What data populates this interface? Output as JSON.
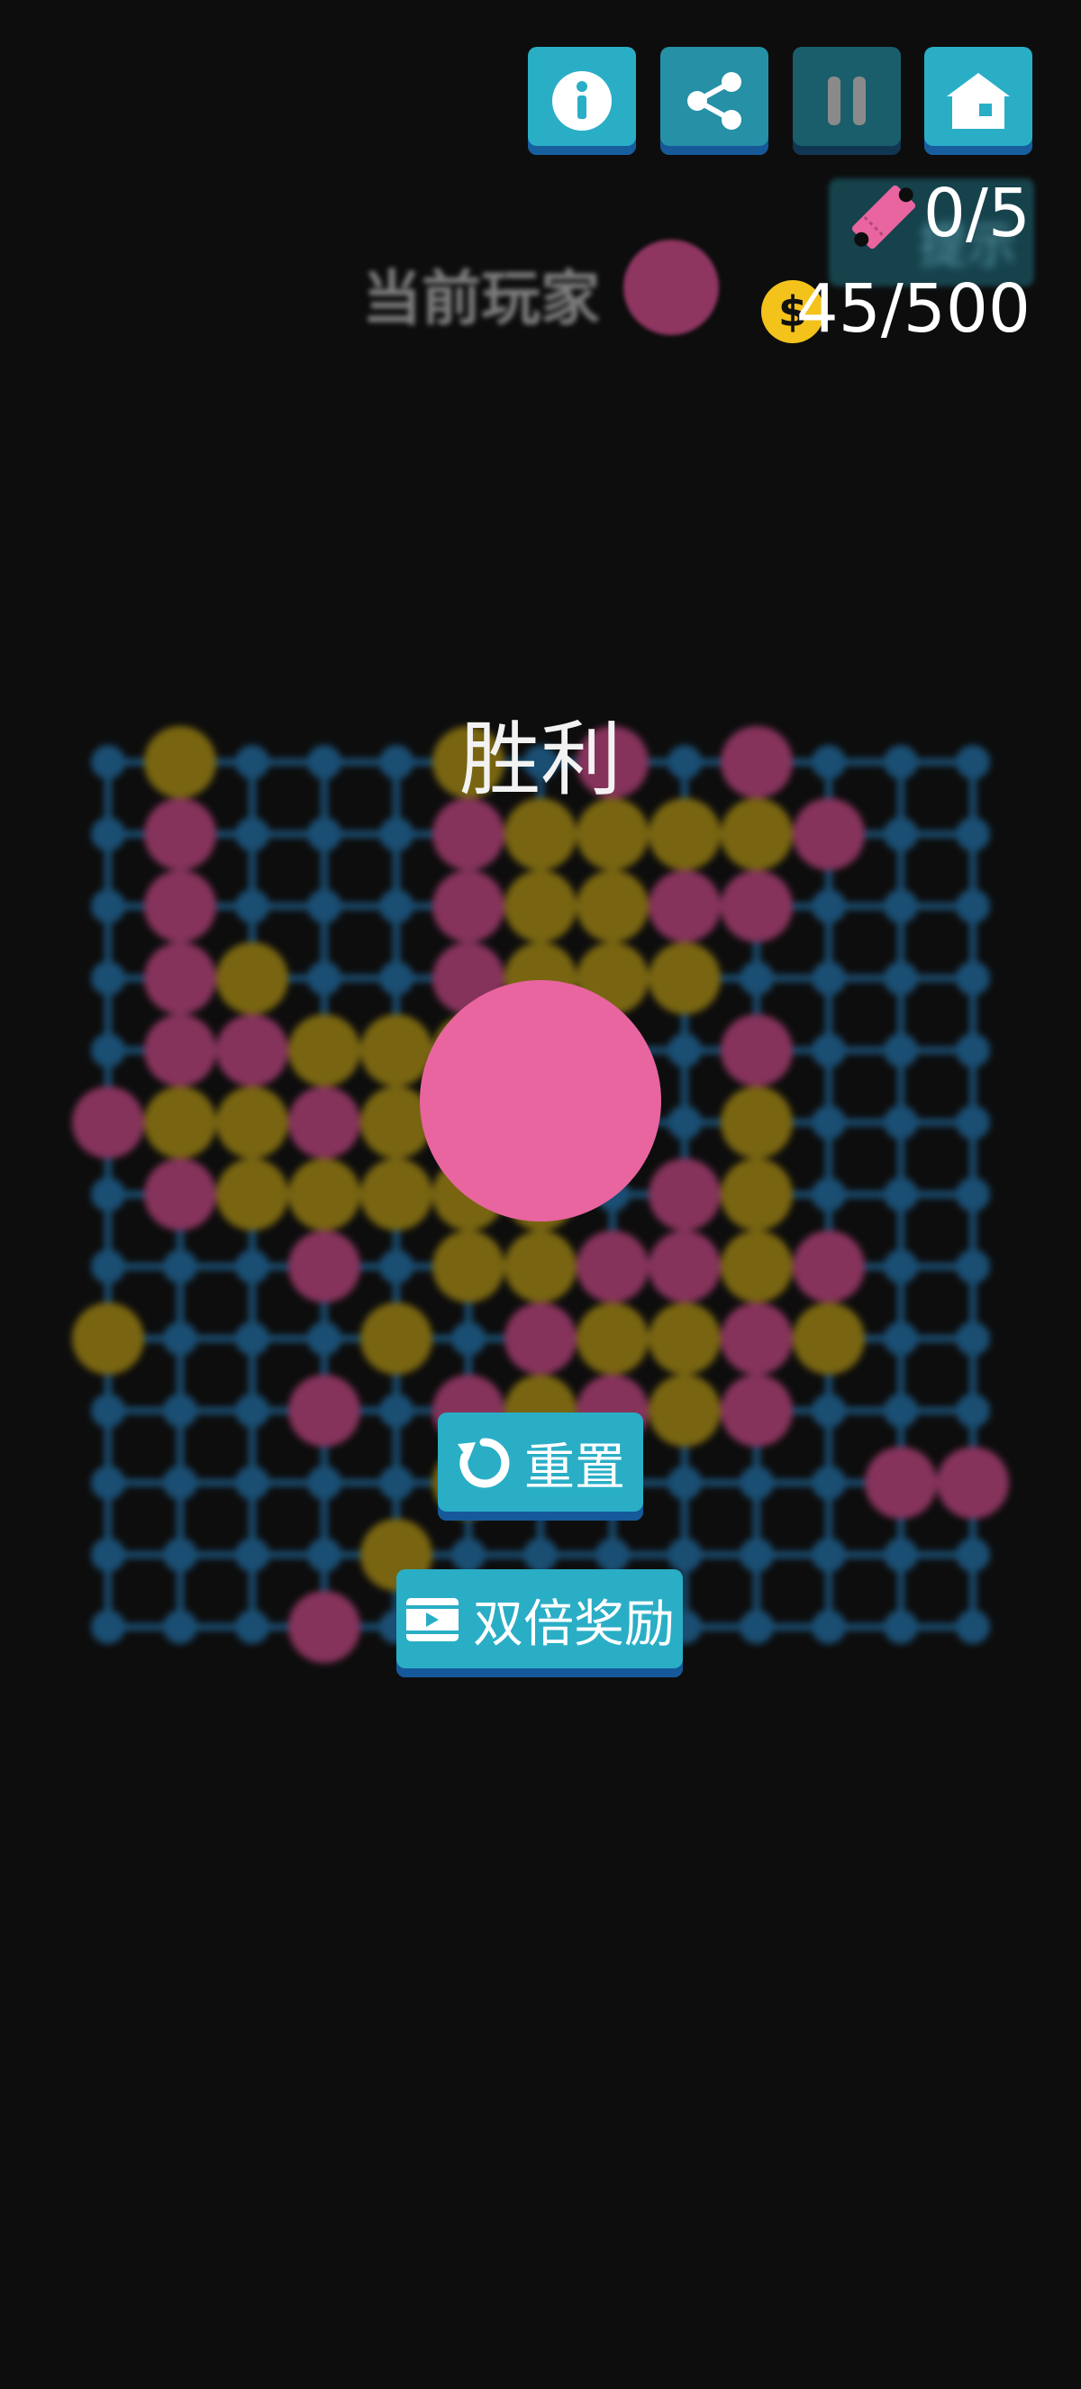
{
  "toolbar": {
    "info_icon": "info-icon",
    "share_icon": "share-icon",
    "pause_icon": "pause-icon",
    "home_icon": "home-icon"
  },
  "hint": {
    "label": "提示",
    "count": "0/5",
    "icon": "ticket-icon"
  },
  "coins": {
    "count": "45/500",
    "icon": "dollar-coin-icon"
  },
  "current_player": {
    "label": "当前玩家",
    "color": "#9c3a6a"
  },
  "result": {
    "title": "胜利",
    "winner_color": "#e8659f"
  },
  "actions": {
    "reset_label": "重置",
    "double_label": "双倍奖励"
  },
  "board": {
    "cols": 13,
    "rows": 13,
    "colors": {
      "pink": "#9c3a6a",
      "yellow": "#8c7512",
      "grid": "#1d5a85"
    },
    "cells": [
      ".Y...Y.P.P...",
      ".P...PYYYYP..",
      ".P...PYYPP...",
      ".PY..PYYY....",
      ".PPYYY...P...",
      "PYYPYY...Y...",
      ".PYYYYY.PY...",
      "...P.YYPPYP..",
      "Y...Y.PYYPY...",
      "...P.PYPYP...",
      ".....Y.....PP",
      "....Y........",
      "...P........."
    ]
  }
}
